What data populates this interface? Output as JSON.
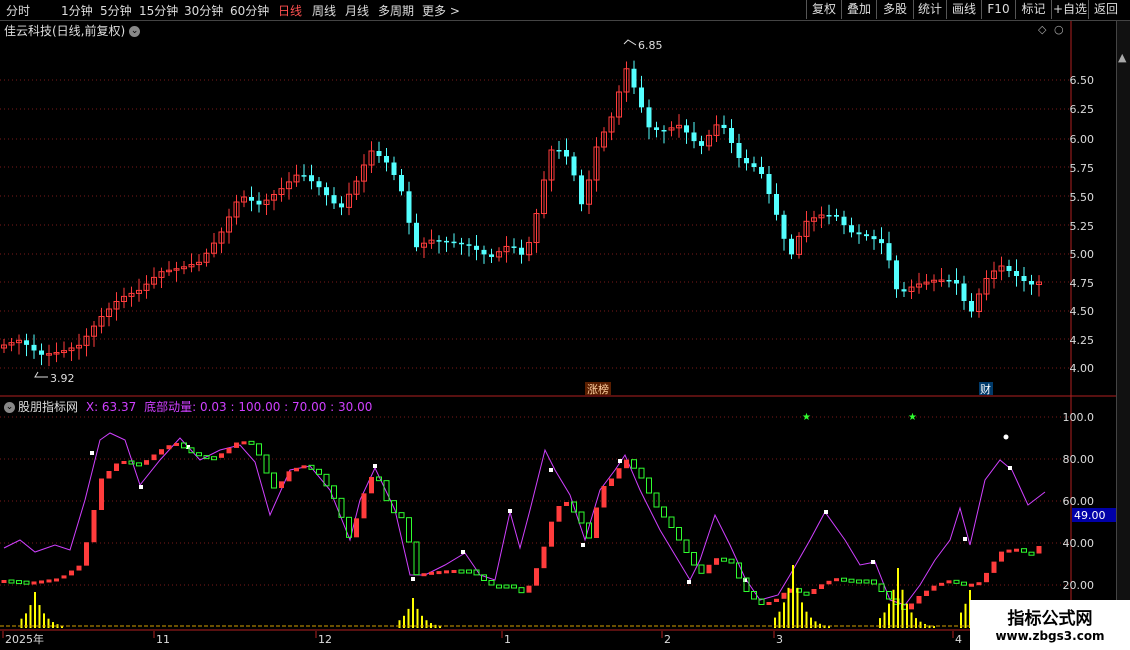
{
  "toolbar": {
    "timeframes": [
      "分时",
      "1分钟",
      "5分钟",
      "15分钟",
      "30分钟",
      "60分钟",
      "日线",
      "周线",
      "月线",
      "多周期",
      "更多 >"
    ],
    "active_timeframe": "日线",
    "right_buttons": [
      "复权",
      "叠加",
      "多股",
      "统计",
      "画线",
      "F10",
      "标记",
      "+自选",
      "返回"
    ]
  },
  "main_chart": {
    "title": "佳云科技(日线,前复权)",
    "high_label": "6.85",
    "low_label": "3.92",
    "y_ticks": [
      "6.50",
      "6.25",
      "6.00",
      "5.75",
      "5.50",
      "5.25",
      "5.00",
      "4.75",
      "4.50",
      "4.25",
      "4.00"
    ],
    "badges": [
      "涨榜",
      "财"
    ]
  },
  "indicator": {
    "name": "股朋指标网",
    "x_label": "X: 63.37",
    "series_label": "底部动量: 0.03 : 100.00 : 70.00 : 30.00",
    "y_ticks": [
      "100.0",
      "80.00",
      "60.00",
      "40.00",
      "20.00"
    ],
    "current_value": "49.00"
  },
  "x_axis": [
    "2025年",
    "11",
    "12",
    "1",
    "2",
    "3",
    "4"
  ],
  "watermark": {
    "line1": "指标公式网",
    "line2": "www.zbgs3.com"
  },
  "colors": {
    "up": "#ff3c3c",
    "down": "#54ffff",
    "purple": "#d040ff",
    "yellow": "#ffff00",
    "green": "#2fff2f",
    "white": "#ffffff"
  }
}
